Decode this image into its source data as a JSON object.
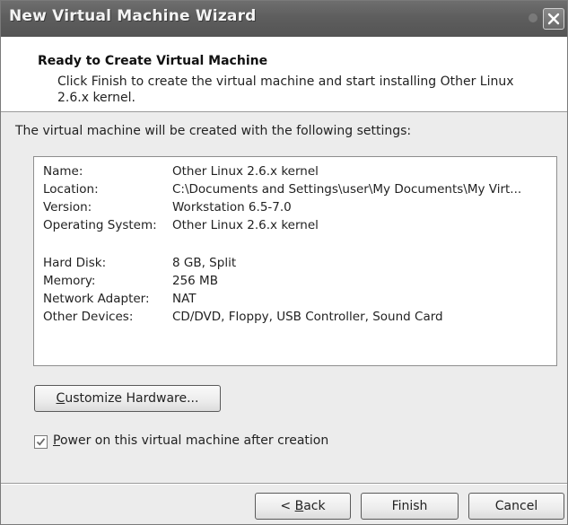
{
  "window": {
    "title": "New Virtual Machine Wizard"
  },
  "header": {
    "title": "Ready to Create Virtual Machine",
    "description": "Click Finish to create the virtual machine and start installing Other Linux 2.6.x kernel."
  },
  "intro_text": "The virtual machine will be created with the following settings:",
  "settings": [
    {
      "label": "Name:",
      "value": "Other Linux 2.6.x kernel"
    },
    {
      "label": "Location:",
      "value": "C:\\Documents and Settings\\user\\My Documents\\My Virt..."
    },
    {
      "label": "Version:",
      "value": "Workstation 6.5-7.0"
    },
    {
      "label": "Operating System:",
      "value": "Other Linux 2.6.x kernel"
    },
    {
      "label": "Hard Disk:",
      "value": "8 GB, Split"
    },
    {
      "label": "Memory:",
      "value": "256 MB"
    },
    {
      "label": "Network Adapter:",
      "value": "NAT"
    },
    {
      "label": "Other Devices:",
      "value": "CD/DVD, Floppy, USB Controller, Sound Card"
    }
  ],
  "customize_button": {
    "mnemonic": "C",
    "rest": "ustomize Hardware..."
  },
  "power_on": {
    "checked": true,
    "mnemonic": "P",
    "rest": "ower on this virtual machine after creation"
  },
  "buttons": {
    "back": {
      "prefix": "< ",
      "mnemonic": "B",
      "rest": "ack"
    },
    "finish": "Finish",
    "cancel": "Cancel"
  },
  "icons": {
    "close": "close-icon",
    "check": "checkmark-icon"
  }
}
